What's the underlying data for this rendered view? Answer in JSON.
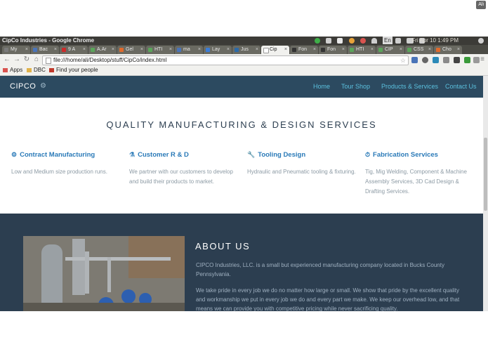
{
  "os_bar": {
    "window_title": "CipCo Industries - Google Chrome",
    "keyboard_indicator": "En",
    "clock": "Fri Apr 10  1:49 PM",
    "user": "Ali"
  },
  "tabs": [
    {
      "label": "My",
      "color": "#7a7a7a"
    },
    {
      "label": "Bac",
      "color": "#4a74b8"
    },
    {
      "label": "9 A",
      "color": "#cc2b2b"
    },
    {
      "label": "A.Ar",
      "color": "#5aa55a"
    },
    {
      "label": "Gel",
      "color": "#e06a2c"
    },
    {
      "label": "HTI",
      "color": "#5aa55a"
    },
    {
      "label": "ma",
      "color": "#4a74b8"
    },
    {
      "label": "Lay",
      "color": "#3b7dd8"
    },
    {
      "label": "Jus",
      "color": "#2c6aa8"
    },
    {
      "label": "Cip",
      "color": "#ffffff",
      "active": true
    },
    {
      "label": "Fon",
      "color": "#333333"
    },
    {
      "label": "Fon",
      "color": "#333333"
    },
    {
      "label": "HTI",
      "color": "#5aa55a"
    },
    {
      "label": "CIP",
      "color": "#5aa55a"
    },
    {
      "label": "CSS",
      "color": "#5aa55a"
    },
    {
      "label": "Cho",
      "color": "#e06a2c"
    }
  ],
  "toolbar": {
    "url": "file:///home/ali/Desktop/stuff/CipCo/index.html"
  },
  "bookmarks": [
    {
      "label": "Apps",
      "color": "#d9534f"
    },
    {
      "label": "DBC",
      "color": "#e0b24a"
    },
    {
      "label": "Find your people",
      "color": "#c0392b"
    }
  ],
  "site": {
    "brand": "CIPCO",
    "nav": [
      "Home",
      "Tour Shop",
      "Products & Services",
      "Contact Us"
    ],
    "services_title": "QUALITY MANUFACTURING & DESIGN SERVICES",
    "services": [
      {
        "title": "Contract Manufacturing",
        "icon": "gear-icon",
        "text": "Low and Medium size production runs."
      },
      {
        "title": "Customer R & D",
        "icon": "flask-icon",
        "text": "We partner with our customers to develop and build their products to market."
      },
      {
        "title": "Tooling Design",
        "icon": "wrench-icon",
        "text": "Hydraulic and Pneumatic tooling & fixturing."
      },
      {
        "title": "Fabrication Services",
        "icon": "dashboard-icon",
        "text": "Tig, Mig Welding, Component & Machine Assembly Services, 3D Cad Design & Drafting Services."
      }
    ],
    "about": {
      "title": "ABOUT US",
      "p1": "CIPCO Industries, LLC. is a small but experienced manufacturing company located in Bucks County Pennsylvania.",
      "p2": "We take pride in every job we do no matter how large or small. We show that pride by the excellent quality and workmanship we put in every job we do and every part we make. We keep our overhead low, and that means we can provide you with competitive pricing while never sacrificing quality."
    }
  },
  "colors": {
    "navbar": "#2c4a60",
    "accent": "#2a7ab8",
    "about_bg": "#2c3e50"
  }
}
